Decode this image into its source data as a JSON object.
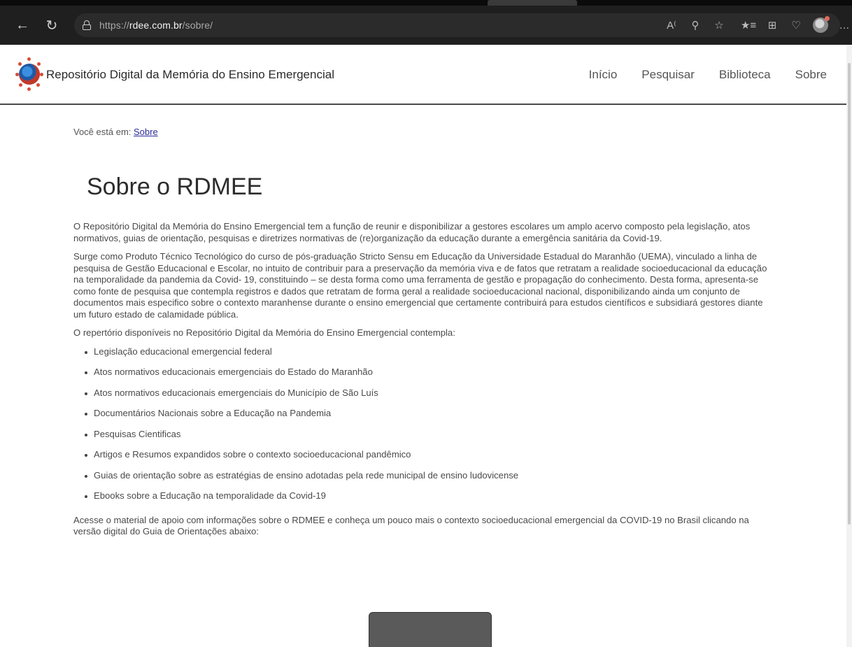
{
  "browser": {
    "url_scheme": "https://",
    "url_domain": "rdee.com.br",
    "url_path": "/sobre/",
    "icons": [
      "back-icon",
      "reload-icon",
      "lock-icon",
      "read-aloud-icon",
      "zoom-icon",
      "favorite-icon",
      "favorites-list-icon",
      "collections-icon",
      "health-icon",
      "profile-icon",
      "more-icon"
    ]
  },
  "site": {
    "title": "Repositório Digital da Memória do Ensino Emergencial",
    "nav": [
      "Início",
      "Pesquisar",
      "Biblioteca",
      "Sobre"
    ]
  },
  "breadcrumb": {
    "prefix": "Você está em:",
    "current": "Sobre"
  },
  "page": {
    "title": "Sobre o RDMEE",
    "paragraphs": [
      "O Repositório Digital da Memória do Ensino Emergencial tem a função de reunir e disponibilizar a gestores escolares um amplo acervo composto pela legislação, atos normativos, guias de orientação, pesquisas e diretrizes normativas de (re)organização da educação durante a emergência sanitária da Covid-19.",
      "Surge como Produto Técnico Tecnológico do curso de pós-graduação Stricto Sensu em Educação da Universidade Estadual do Maranhão (UEMA), vinculado a linha de pesquisa de Gestão Educacional e Escolar, no intuito de contribuir para a preservação da memória viva e de fatos que retratam a realidade socioeducacional da educação na temporalidade da pandemia da Covid- 19, constituindo – se desta forma como uma ferramenta de gestão e propagação do conhecimento. Desta forma, apresenta-se como fonte de pesquisa que contempla registros e dados que retratam de forma geral a realidade socioeducacional nacional, disponibilizando ainda um conjunto de documentos mais especifico sobre o contexto maranhense durante o ensino emergencial que certamente contribuirá para estudos científicos e subsidiará gestores diante um futuro estado de calamidade pública.",
      "O repertório disponíveis no Repositório Digital da Memória do Ensino Emergencial contempla:"
    ],
    "list": [
      "Legislação educacional emergencial federal",
      "Atos normativos educacionais emergenciais do Estado do Maranhão",
      "Atos normativos educacionais emergenciais do Município de São Luís",
      "Documentários Nacionais sobre a Educação na Pandemia",
      "Pesquisas Cientificas",
      "Artigos e Resumos expandidos sobre o contexto socioeducacional pandêmico",
      "Guias de orientação sobre as estratégias de ensino adotadas pela rede municipal de ensino ludovicense",
      "Ebooks sobre a Educação na temporalidade da Covid-19"
    ],
    "closing": "Acesse o material de apoio com informações sobre o RDMEE e conheça um pouco mais o contexto socioeducacional emergencial da COVID-19 no Brasil clicando na versão digital do Guia de Orientações abaixo:"
  }
}
